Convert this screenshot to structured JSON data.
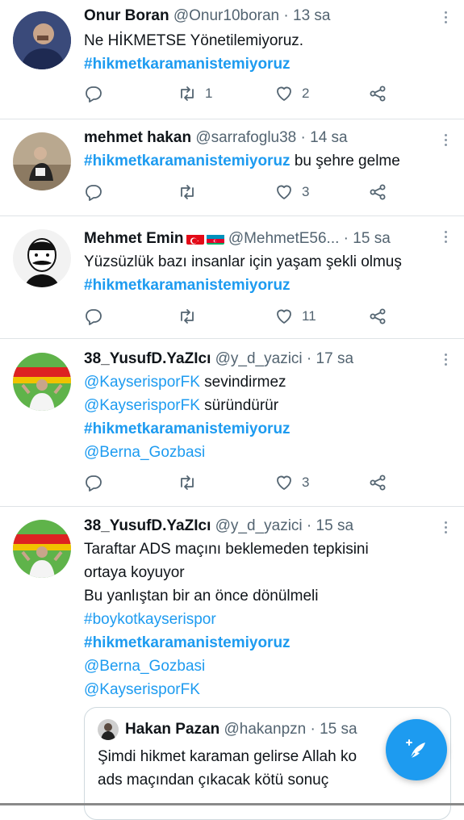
{
  "tweets": [
    {
      "name": "Onur Boran",
      "handle": "@Onur10boran",
      "time": "· 13 sa",
      "lines": [
        "Ne HİKMETSE Yönetilemiyoruz.",
        "#hikmetkaramanistemiyoruz"
      ],
      "retweets": "1",
      "likes": "2"
    },
    {
      "name": "mehmet hakan",
      "handle": "@sarrafoglu38",
      "time": "· 14 sa",
      "hashtag": "#hikmetkaramanistemiyoruz",
      "text_after": " bu şehre gelme",
      "retweets": "",
      "likes": "3"
    },
    {
      "name": "Mehmet Emin",
      "handle": "@MehmetE56...",
      "time": "· 15 sa",
      "lines": [
        "Yüzsüzlük bazı insanlar için yaşam şekli olmuş",
        "#hikmetkaramanistemiyoruz"
      ],
      "retweets": "",
      "likes": "11"
    },
    {
      "name": "38_YusufD.YaZIcı",
      "handle": "@y_d_yazici",
      "time": "· 17 sa",
      "mention1": "@KayserisporFK",
      "text1": " sevindirmez",
      "mention2": "@KayserisporFK",
      "text2": " süründürür",
      "hashtag": "#hikmetkaramanistemiyoruz",
      "mention3": "@Berna_Gozbasi",
      "retweets": "",
      "likes": "3"
    },
    {
      "name": "38_YusufD.YaZIcı",
      "handle": "@y_d_yazici",
      "time": "· 15 sa",
      "lines": [
        "Taraftar ADS maçını beklemeden tepkisini",
        "ortaya koyuyor",
        "Bu yanlıştan bir an önce dönülmeli"
      ],
      "hashtag1": "#boykotkayserispor",
      "hashtag2": "#hikmetkaramanistemiyoruz",
      "mention1": "@Berna_Gozbasi",
      "mention2": "@KayserisporFK",
      "quote": {
        "name": "Hakan Pazan",
        "handle": "@hakanpzn",
        "time": "· 15 sa",
        "lines": [
          "Şimdi  hikmet karaman gelirse Allah ko",
          "ads maçından çıkacak kötü sonuç"
        ]
      }
    }
  ],
  "icons": [
    "reply-icon",
    "retweet-icon",
    "like-icon",
    "share-icon",
    "more-icon",
    "compose-icon"
  ],
  "colors": {
    "accent": "#1d9bf0",
    "text": "#0f1419",
    "muted": "#536471",
    "divider": "#dfe3e6"
  }
}
